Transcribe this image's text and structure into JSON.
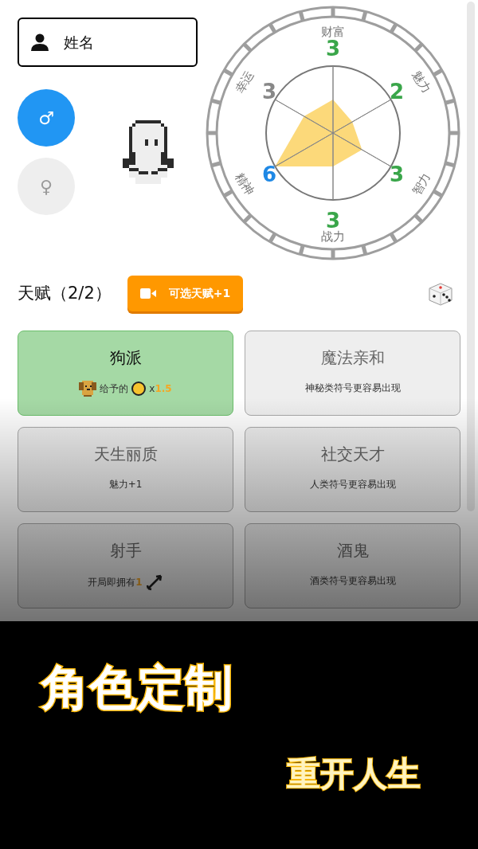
{
  "name_field": {
    "placeholder": "姓名"
  },
  "genders": [
    {
      "symbol": "♂",
      "selected": true
    },
    {
      "symbol": "♀",
      "selected": false
    }
  ],
  "stats": [
    {
      "label": "财富",
      "value": "3",
      "color": "#3aa64a"
    },
    {
      "label": "魅力",
      "value": "2",
      "color": "#3aa64a"
    },
    {
      "label": "智力",
      "value": "3",
      "color": "#3aa64a"
    },
    {
      "label": "战力",
      "value": "3",
      "color": "#3aa64a"
    },
    {
      "label": "精神",
      "value": "6",
      "color": "#1e88e5"
    },
    {
      "label": "幸运",
      "value": "3",
      "color": "#888888"
    }
  ],
  "talents_header": {
    "title": "天赋（2/2）",
    "button": "可选天赋+1"
  },
  "talents": [
    {
      "name": "狗派",
      "selected": true,
      "desc": [
        {
          "kind": "dog"
        },
        {
          "kind": "text",
          "text": "给予的"
        },
        {
          "kind": "coin"
        },
        {
          "kind": "text",
          "text": "x"
        },
        {
          "kind": "accent",
          "text": "1.5"
        }
      ]
    },
    {
      "name": "魔法亲和",
      "selected": false,
      "desc": [
        {
          "kind": "text",
          "text": "神秘类符号更容易出现"
        }
      ]
    },
    {
      "name": "天生丽质",
      "selected": false,
      "desc": [
        {
          "kind": "text",
          "text": "魅力+1"
        }
      ]
    },
    {
      "name": "社交天才",
      "selected": false,
      "desc": [
        {
          "kind": "text",
          "text": "人类符号更容易出现"
        }
      ]
    },
    {
      "name": "射手",
      "selected": false,
      "desc": [
        {
          "kind": "text",
          "text": "开局即拥有"
        },
        {
          "kind": "accent",
          "text": "1"
        },
        {
          "kind": "arrow"
        }
      ]
    },
    {
      "name": "酒鬼",
      "selected": false,
      "desc": [
        {
          "kind": "text",
          "text": "酒类符号更容易出现"
        }
      ]
    }
  ],
  "captions": [
    "角色定制",
    "重开人生"
  ]
}
